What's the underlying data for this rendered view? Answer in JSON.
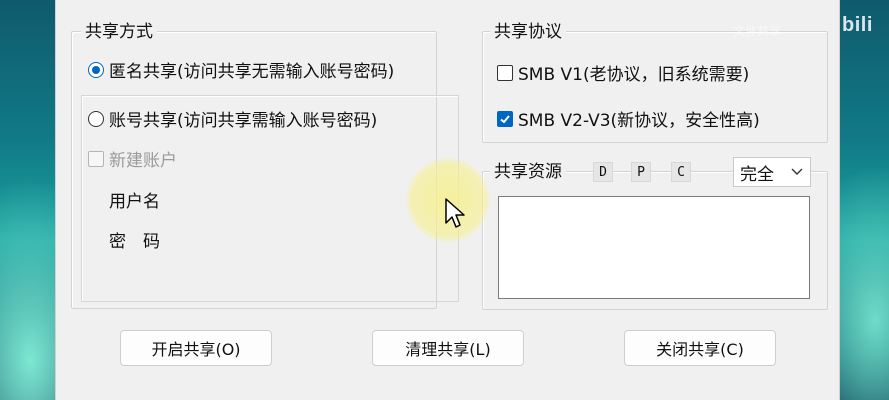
{
  "share_mode": {
    "title": "共享方式",
    "anonymous_label": "匿名共享(访问共享无需输入账号密码)",
    "account_label": "账号共享(访问共享需输入账号密码)",
    "new_account_label": "新建账户",
    "username_label": "用户名",
    "password_label": "密　码",
    "selected": "anonymous"
  },
  "share_protocol": {
    "title": "共享协议",
    "smb1_label": "SMB V1(老协议，旧系统需要)",
    "smb1_checked": false,
    "smb2_label": "SMB V2-V3(新协议，安全性高)",
    "smb2_checked": true
  },
  "share_resource": {
    "label": "共享资源",
    "drives": [
      "D",
      "P",
      "C"
    ],
    "permission_value": "完全"
  },
  "buttons": {
    "open": "开启共享(O)",
    "clean": "清理共享(L)",
    "close": "关闭共享(C)"
  },
  "overlay": {
    "logo": "bili",
    "watermark": "文件共享"
  },
  "icons": {
    "cursor": "mouse-pointer-icon",
    "dropdown": "chevron-down-icon",
    "check": "checkmark-icon"
  },
  "colors": {
    "accent": "#0067c0",
    "dialog_bg": "#f0f0f0",
    "cursor_highlight": "#f6f08c"
  }
}
